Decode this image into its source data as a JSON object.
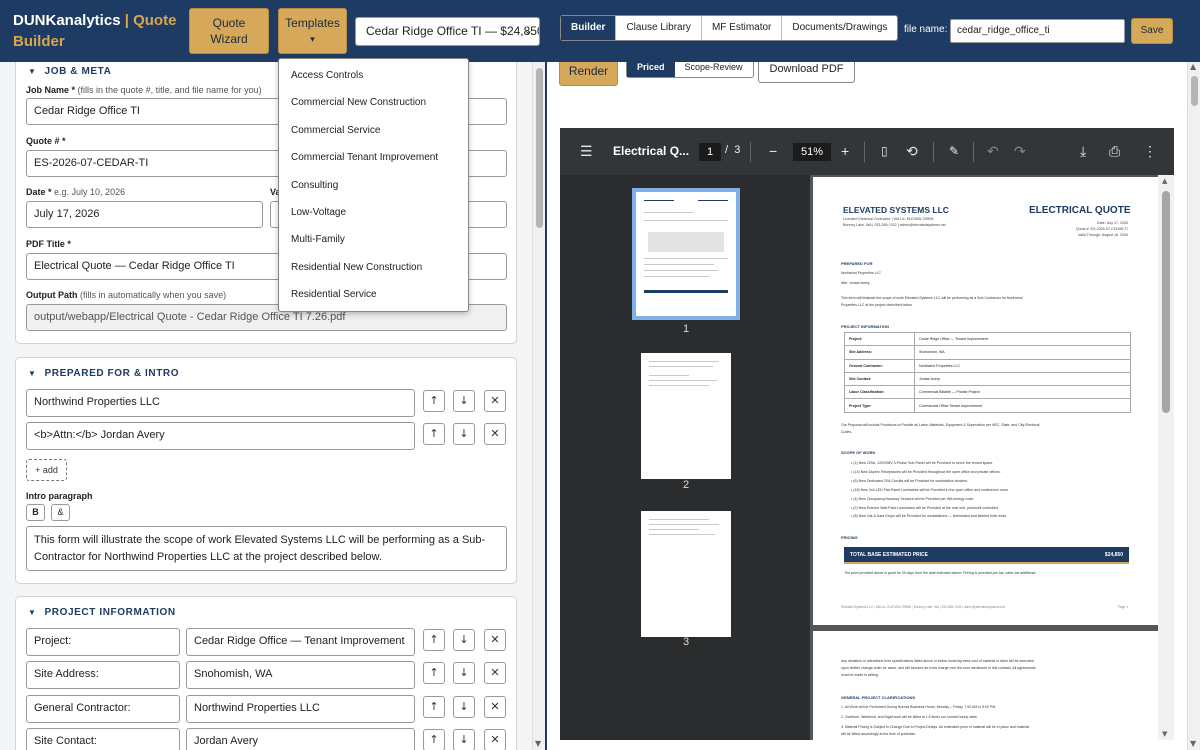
{
  "header": {
    "brand_main": "DUNKanalytics",
    "brand_sep": "|",
    "brand_quote": "Quote",
    "brand_builder": "Builder",
    "quote_wizard_line1": "Quote",
    "quote_wizard_line2": "Wizard",
    "templates_label": "Templates",
    "templates_caret": "▾",
    "job_select": "Cedar Ridge Office TI — $24,850",
    "tabs": [
      "Builder",
      "Clause Library",
      "MF Estimator",
      "Documents/Drawings"
    ],
    "file_name_label": "file name:",
    "file_name_value": "cedar_ridge_office_ti",
    "save_label": "Save"
  },
  "templates_menu": [
    "Access Controls",
    "Commercial New Construction",
    "Commercial Service",
    "Commercial Tenant Improvement",
    "Consulting",
    "Low-Voltage",
    "Multi-Family",
    "Residential New Construction",
    "Residential Service"
  ],
  "job_meta": {
    "title": "JOB & META",
    "job_name_label": "Job Name *",
    "job_name_hint": "(fills in the quote #, title, and file name for you)",
    "job_name_value": "Cedar Ridge Office TI",
    "quote_no_label": "Quote # *",
    "quote_no_value": "ES-2026-07-CEDAR-TI",
    "date_label": "Date *",
    "date_hint": "e.g. July 10, 2026",
    "date_value": "July 17, 2026",
    "valid_label": "Va",
    "pdf_title_label": "PDF Title *",
    "pdf_title_value": "Electrical Quote — Cedar Ridge Office TI",
    "output_label": "Output Path",
    "output_hint": "(fills in automatically when you save)",
    "output_value": "output/webapp/Electrical Quote - Cedar Ridge Office TI 7.26.pdf"
  },
  "prepared": {
    "title": "PREPARED FOR & INTRO",
    "lines": [
      "Northwind Properties LLC",
      "<b>Attn:</b> Jordan Avery"
    ],
    "add_label": "+ add",
    "intro_label": "Intro paragraph",
    "bold_btn": "B",
    "amp_btn": "&",
    "intro_text": "This form will illustrate the scope of work Elevated Systems LLC will be performing as a Sub-Contractor for Northwind Properties LLC at the project described below."
  },
  "project_info": {
    "title": "PROJECT INFORMATION",
    "rows": [
      {
        "key": "Project:",
        "value": "Cedar Ridge Office — Tenant Improvement"
      },
      {
        "key": "Site Address:",
        "value": "Snohomish, WA"
      },
      {
        "key": "General Contractor:",
        "value": "Northwind Properties LLC"
      },
      {
        "key": "Site Contact:",
        "value": "Jordan Avery"
      }
    ]
  },
  "icons": {
    "up": "↑",
    "down": "↓",
    "remove": "✕"
  },
  "preview": {
    "render_label": "Render",
    "mode_tabs": [
      "Priced",
      "Scope-Review"
    ],
    "download_label": "Download PDF"
  },
  "viewer": {
    "title": "Electrical Q...",
    "page_current": "1",
    "page_sep": "/",
    "page_total": "3",
    "zoom": "51%",
    "thumb_labels": [
      "1",
      "2",
      "3"
    ],
    "page1": {
      "company": "ELEVATED SYSTEMS LLC",
      "company_sub1": "Licensed Electrical Contractor  |  WA Lic. ELEVASL799BN",
      "company_sub2": "Bonney Lake, WA  |  253-285-7422  |  admin@elevatedsystems.net",
      "doc_title": "ELECTRICAL QUOTE",
      "date_line": "Date: July 17, 2026",
      "quote_line": "Quote #: ES-2026-07-CEDAR-TI",
      "valid_line": "Valid Through: August 16, 2026",
      "prepared_heading": "PREPARED FOR",
      "prepared_lines": [
        "Northwind Properties LLC",
        "Attn: Jordan Avery"
      ],
      "intro_1": "This form will illustrate the scope of work Elevated Systems LLC will be performing as a Sub-Contractor for Northwind",
      "intro_2": "Properties LLC at the project described below.",
      "project_heading": "PROJECT INFORMATION",
      "table": [
        [
          "Project:",
          "Cedar Ridge Office — Tenant Improvement"
        ],
        [
          "Site Address:",
          "Snohomish, WA"
        ],
        [
          "General Contractor:",
          "Northwind Properties LLC"
        ],
        [
          "Site Contact:",
          "Jordan Avery"
        ],
        [
          "Labor Classification:",
          "Commercial Billable — Private Project"
        ],
        [
          "Project Type:",
          "Commercial Office Tenant Improvement"
        ]
      ],
      "provisions_1": "Our Proposal will include Provisions to Provide all Labor, Materials, Equipment & Supervision per NEC, State, and City Electrical",
      "provisions_2": "Codes.",
      "scope_heading": "SCOPE OF WORK",
      "scope_items": [
        "• (1) New 225A, 120/208V 3-Phase Sub-Panel will be Provided to serve the tenant space.",
        "• (14) New Duplex Receptacles will be Provided throughout the open office and private offices.",
        "• (6) New Dedicated 20A Circuits will be Provided for workstation clusters.",
        "• (18) New 2x4 LED Flat-Panel Luminaires will be Provided in the open office and conference room.",
        "• (4) New Occupancy/Vacancy Sensors will be Provided per WA energy code.",
        "• (2) New Exterior Wall-Pack Luminaires will be Provided at the rear exit, photocell controlled.",
        "• (8) New Cat-6 Data Drops will be Provided for workstations — terminated and labeled both ends."
      ],
      "pricing_heading": "PRICING",
      "price_label": "TOTAL BASE ESTIMATED PRICE",
      "price_value": "$24,850",
      "price_note": "The price provided above is good for 30 days from the date indicated above. Pricing is provided pre-tax; sales tax additional.",
      "footer_left": "Elevated Systems LLC  |  WA Lic. ELEVASL799BN  |  Bonney Lake, WA  |  253-285-7422  |  admin@elevatedsystems.net",
      "footer_right": "Page 1"
    },
    "page2": {
      "para_1": "Any deviation or alterations from specifications listed above or below involving extra cost of material or labor will be executed",
      "para_2": "upon written change order for same, and will become an extra charge over the sum mentioned in this contract. All agreements",
      "para_3": "must be made in writing.",
      "clar_heading": "GENERAL PROJECT CLARIFICATIONS",
      "clar_items": [
        "1.  All Work will be Performed During Normal Business Hours, Monday – Friday, 7:00 AM to 5:00 PM.",
        "2.  Overtime, Weekend, and Night work will be billed at 1.5 times our normal hourly rates.",
        "3.  Material Pricing is Subject to Change Due to Project Delays. An estimated price of material will be in place and material",
        "     will be billed accordingly at the time of purchase."
      ]
    }
  }
}
